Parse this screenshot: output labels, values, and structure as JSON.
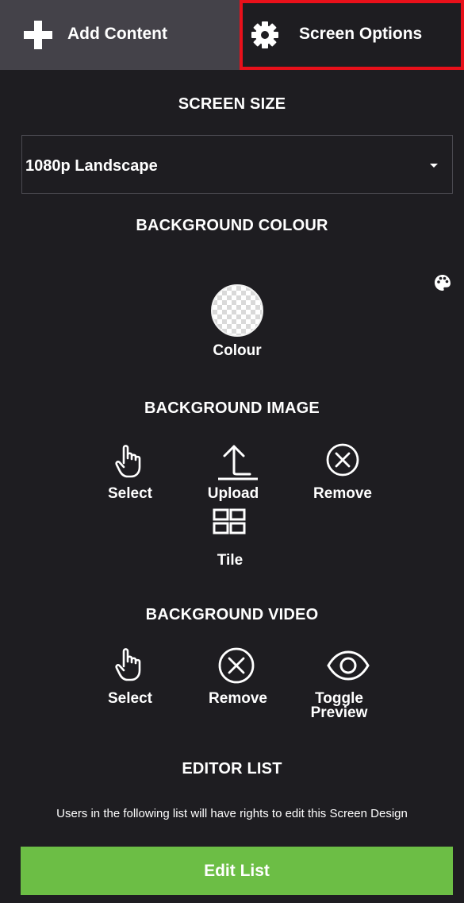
{
  "tabs": {
    "add_content": {
      "label": "Add Content",
      "icon": "plus-icon"
    },
    "screen_options": {
      "label": "Screen Options",
      "icon": "gear-icon"
    }
  },
  "screen_size": {
    "title": "SCREEN SIZE",
    "selected": "1080p Landscape"
  },
  "background_colour": {
    "title": "BACKGROUND COLOUR",
    "colour_label": "Colour",
    "palette_icon": "palette-icon"
  },
  "background_image": {
    "title": "BACKGROUND IMAGE",
    "actions": [
      {
        "label": "Select",
        "icon": "hand-pointer-icon"
      },
      {
        "label": "Upload",
        "icon": "upload-arrow-icon"
      },
      {
        "label": "Remove",
        "icon": "circle-x-icon"
      },
      {
        "label": "Tile",
        "icon": "tile-grid-icon"
      }
    ]
  },
  "background_video": {
    "title": "BACKGROUND VIDEO",
    "actions": [
      {
        "label": "Select",
        "icon": "hand-pointer-icon"
      },
      {
        "label": "Remove",
        "icon": "circle-x-icon"
      },
      {
        "label": "Toggle Preview",
        "icon": "eye-icon"
      }
    ]
  },
  "editor_list": {
    "title": "EDITOR LIST",
    "description": "Users in the following list will have rights to edit this Screen Design",
    "button_label": "Edit List"
  },
  "colors": {
    "background": "#1e1d21",
    "active_tab_outline": "#e8101a",
    "button_green": "#6cbe45",
    "inactive_tab": "#444249"
  }
}
